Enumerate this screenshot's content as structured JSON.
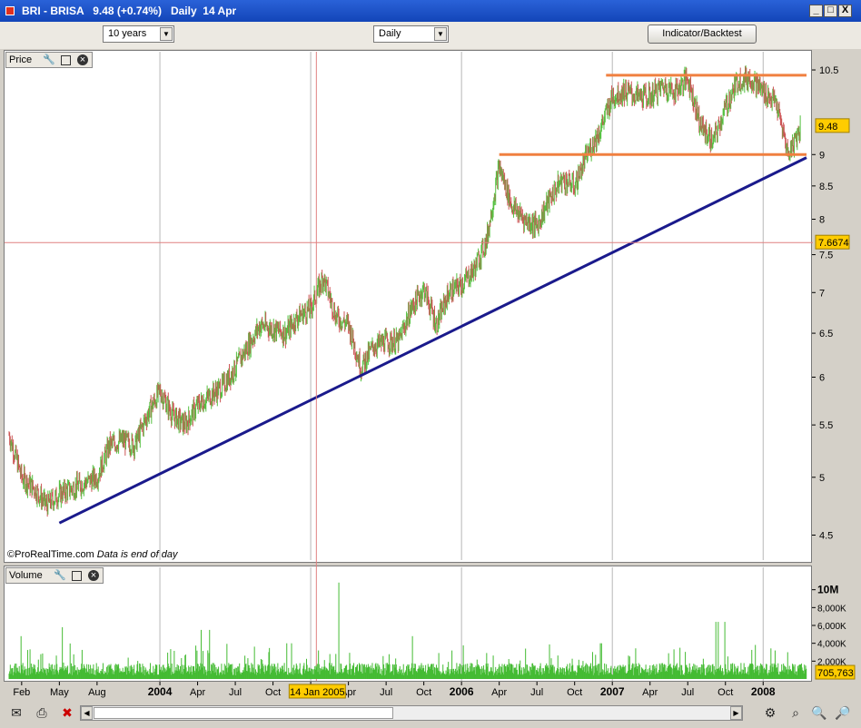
{
  "window": {
    "title": "BRI - BRISA   9.48 (+0.74%)   Daily  14 Apr",
    "minimize": "_",
    "restore": "□",
    "close": "X"
  },
  "toolbar": {
    "period": "10 years",
    "interval": "Daily",
    "indicator_button": "Indicator/Backtest"
  },
  "price_panel": {
    "label": "Price",
    "credit": "©ProRealTime.com",
    "credit_note": "Data is end of day",
    "last_price": "9.48",
    "cursor_price": "7.6674"
  },
  "volume_panel": {
    "label": "Volume",
    "last_volume": "705,763"
  },
  "cursor_date": "14 Jan 2005",
  "icons": [
    "mail-icon",
    "print-icon",
    "delete-icon",
    "zoom-fit-icon",
    "zoom-in-icon",
    "zoom-out-icon",
    "settings-icon"
  ],
  "colors": {
    "up_candle": "#55c040",
    "down_candle": "#cc5555",
    "trendline": "#1a1a8c",
    "horizontal_lines": "#f08040",
    "cursor_line": "#e08080",
    "price_tag": "#ffcc00",
    "volume_bars": "#44bb33"
  },
  "chart_data": [
    {
      "type": "candlestick",
      "title": "",
      "x_ticks": [
        "Feb",
        "May",
        "Aug",
        "2004",
        "Apr",
        "Jul",
        "Oct",
        "2005",
        "Apr",
        "Jul",
        "Oct",
        "2006",
        "Apr",
        "Jul",
        "Oct",
        "2007",
        "Apr",
        "Jul",
        "Oct",
        "2008"
      ],
      "y_ticks": [
        "10.5",
        "9",
        "8.5",
        "8",
        "7.5",
        "7",
        "6.5",
        "6",
        "5.5",
        "5",
        "4.5"
      ],
      "ylim": [
        4.3,
        10.8
      ],
      "y_scale": "log",
      "approx_closes": [
        [
          "2003-01",
          5.4
        ],
        [
          "2003-02",
          5.0
        ],
        [
          "2003-03",
          4.9
        ],
        [
          "2003-04",
          4.75
        ],
        [
          "2003-05",
          4.85
        ],
        [
          "2003-06",
          4.9
        ],
        [
          "2003-07",
          4.95
        ],
        [
          "2003-08",
          5.0
        ],
        [
          "2003-09",
          5.3
        ],
        [
          "2003-10",
          5.35
        ],
        [
          "2003-11",
          5.3
        ],
        [
          "2003-12",
          5.6
        ],
        [
          "2004-01",
          5.85
        ],
        [
          "2004-02",
          5.6
        ],
        [
          "2004-03",
          5.5
        ],
        [
          "2004-04",
          5.7
        ],
        [
          "2004-05",
          5.8
        ],
        [
          "2004-06",
          5.9
        ],
        [
          "2004-07",
          6.1
        ],
        [
          "2004-08",
          6.35
        ],
        [
          "2004-09",
          6.6
        ],
        [
          "2004-10",
          6.55
        ],
        [
          "2004-11",
          6.5
        ],
        [
          "2004-12",
          6.7
        ],
        [
          "2005-01",
          6.8
        ],
        [
          "2005-02",
          7.2
        ],
        [
          "2005-03",
          6.7
        ],
        [
          "2005-04",
          6.6
        ],
        [
          "2005-05",
          6.1
        ],
        [
          "2005-06",
          6.35
        ],
        [
          "2005-07",
          6.4
        ],
        [
          "2005-08",
          6.4
        ],
        [
          "2005-09",
          6.8
        ],
        [
          "2005-10",
          7.05
        ],
        [
          "2005-11",
          6.6
        ],
        [
          "2005-12",
          7.0
        ],
        [
          "2006-01",
          7.1
        ],
        [
          "2006-02",
          7.3
        ],
        [
          "2006-03",
          7.7
        ],
        [
          "2006-04",
          8.8
        ],
        [
          "2006-05",
          8.2
        ],
        [
          "2006-06",
          8.0
        ],
        [
          "2006-07",
          7.9
        ],
        [
          "2006-08",
          8.3
        ],
        [
          "2006-09",
          8.6
        ],
        [
          "2006-10",
          8.5
        ],
        [
          "2006-11",
          9.0
        ],
        [
          "2006-12",
          9.4
        ],
        [
          "2007-01",
          10.0
        ],
        [
          "2007-02",
          10.1
        ],
        [
          "2007-03",
          10.0
        ],
        [
          "2007-04",
          10.0
        ],
        [
          "2007-05",
          10.2
        ],
        [
          "2007-06",
          10.1
        ],
        [
          "2007-07",
          10.35
        ],
        [
          "2007-08",
          9.5
        ],
        [
          "2007-09",
          9.2
        ],
        [
          "2007-10",
          9.8
        ],
        [
          "2007-11",
          10.3
        ],
        [
          "2007-12",
          10.35
        ],
        [
          "2008-01",
          10.1
        ],
        [
          "2008-02",
          9.9
        ],
        [
          "2008-03",
          9.0
        ],
        [
          "2008-04",
          9.48
        ]
      ],
      "horizontal_lines": [
        10.4,
        9.0
      ],
      "trendline": [
        [
          "2003-05",
          4.6
        ],
        [
          "2008-04",
          8.95
        ]
      ],
      "cursor": {
        "date": "14 Jan 2005",
        "price": 7.6674
      },
      "last_price": 9.48
    },
    {
      "type": "bar",
      "title": "Volume",
      "y_ticks": [
        "10M",
        "8,000K",
        "6,000K",
        "4,000K",
        "2,000K"
      ],
      "ylim": [
        0,
        12000000
      ],
      "approx_monthly_peaks": [
        [
          "2003-01",
          4800000
        ],
        [
          "2003-05",
          5800000
        ],
        [
          "2003-08",
          5600000
        ],
        [
          "2004-04",
          5500000
        ],
        [
          "2004-11",
          4000000
        ],
        [
          "2005-03",
          10800000
        ],
        [
          "2005-09",
          4800000
        ],
        [
          "2006-04",
          7000000
        ],
        [
          "2006-12",
          4000000
        ],
        [
          "2007-06",
          3500000
        ],
        [
          "2007-09",
          6400000
        ],
        [
          "2008-02",
          3000000
        ]
      ],
      "last_volume": 705763
    }
  ]
}
